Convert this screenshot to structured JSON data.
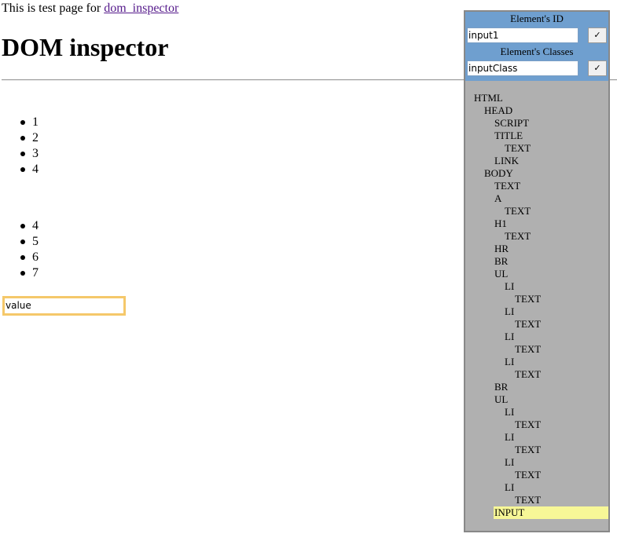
{
  "page": {
    "intro_text": "This is test page for ",
    "intro_link": "dom_inspector",
    "title": "DOM inspector",
    "list1": [
      "1",
      "2",
      "3",
      "4"
    ],
    "list2": [
      "4",
      "5",
      "6",
      "7"
    ],
    "input_value": "value"
  },
  "inspector": {
    "id_label": "Element's ID",
    "id_value": "input1",
    "id_button": "✓",
    "classes_label": "Element's Classes",
    "classes_value": "inputClass",
    "classes_button": "✓",
    "tree": [
      {
        "label": "HTML",
        "depth": 0
      },
      {
        "label": "HEAD",
        "depth": 1
      },
      {
        "label": "SCRIPT",
        "depth": 2
      },
      {
        "label": "TITLE",
        "depth": 2
      },
      {
        "label": "TEXT",
        "depth": 3
      },
      {
        "label": "LINK",
        "depth": 2
      },
      {
        "label": "BODY",
        "depth": 1
      },
      {
        "label": "TEXT",
        "depth": 2
      },
      {
        "label": "A",
        "depth": 2
      },
      {
        "label": "TEXT",
        "depth": 3
      },
      {
        "label": "H1",
        "depth": 2
      },
      {
        "label": "TEXT",
        "depth": 3
      },
      {
        "label": "HR",
        "depth": 2
      },
      {
        "label": "BR",
        "depth": 2
      },
      {
        "label": "UL",
        "depth": 2
      },
      {
        "label": "LI",
        "depth": 3
      },
      {
        "label": "TEXT",
        "depth": 4
      },
      {
        "label": "LI",
        "depth": 3
      },
      {
        "label": "TEXT",
        "depth": 4
      },
      {
        "label": "LI",
        "depth": 3
      },
      {
        "label": "TEXT",
        "depth": 4
      },
      {
        "label": "LI",
        "depth": 3
      },
      {
        "label": "TEXT",
        "depth": 4
      },
      {
        "label": "BR",
        "depth": 2
      },
      {
        "label": "UL",
        "depth": 2
      },
      {
        "label": "LI",
        "depth": 3
      },
      {
        "label": "TEXT",
        "depth": 4
      },
      {
        "label": "LI",
        "depth": 3
      },
      {
        "label": "TEXT",
        "depth": 4
      },
      {
        "label": "LI",
        "depth": 3
      },
      {
        "label": "TEXT",
        "depth": 4
      },
      {
        "label": "LI",
        "depth": 3
      },
      {
        "label": "TEXT",
        "depth": 4
      },
      {
        "label": "INPUT",
        "depth": 2,
        "selected": true
      }
    ]
  },
  "colors": {
    "panel_header": "#6f9fcf",
    "panel_body": "#b0b0b0",
    "selected_node": "#f7f797",
    "input_border": "#f5c86a",
    "link": "#551a8b"
  }
}
